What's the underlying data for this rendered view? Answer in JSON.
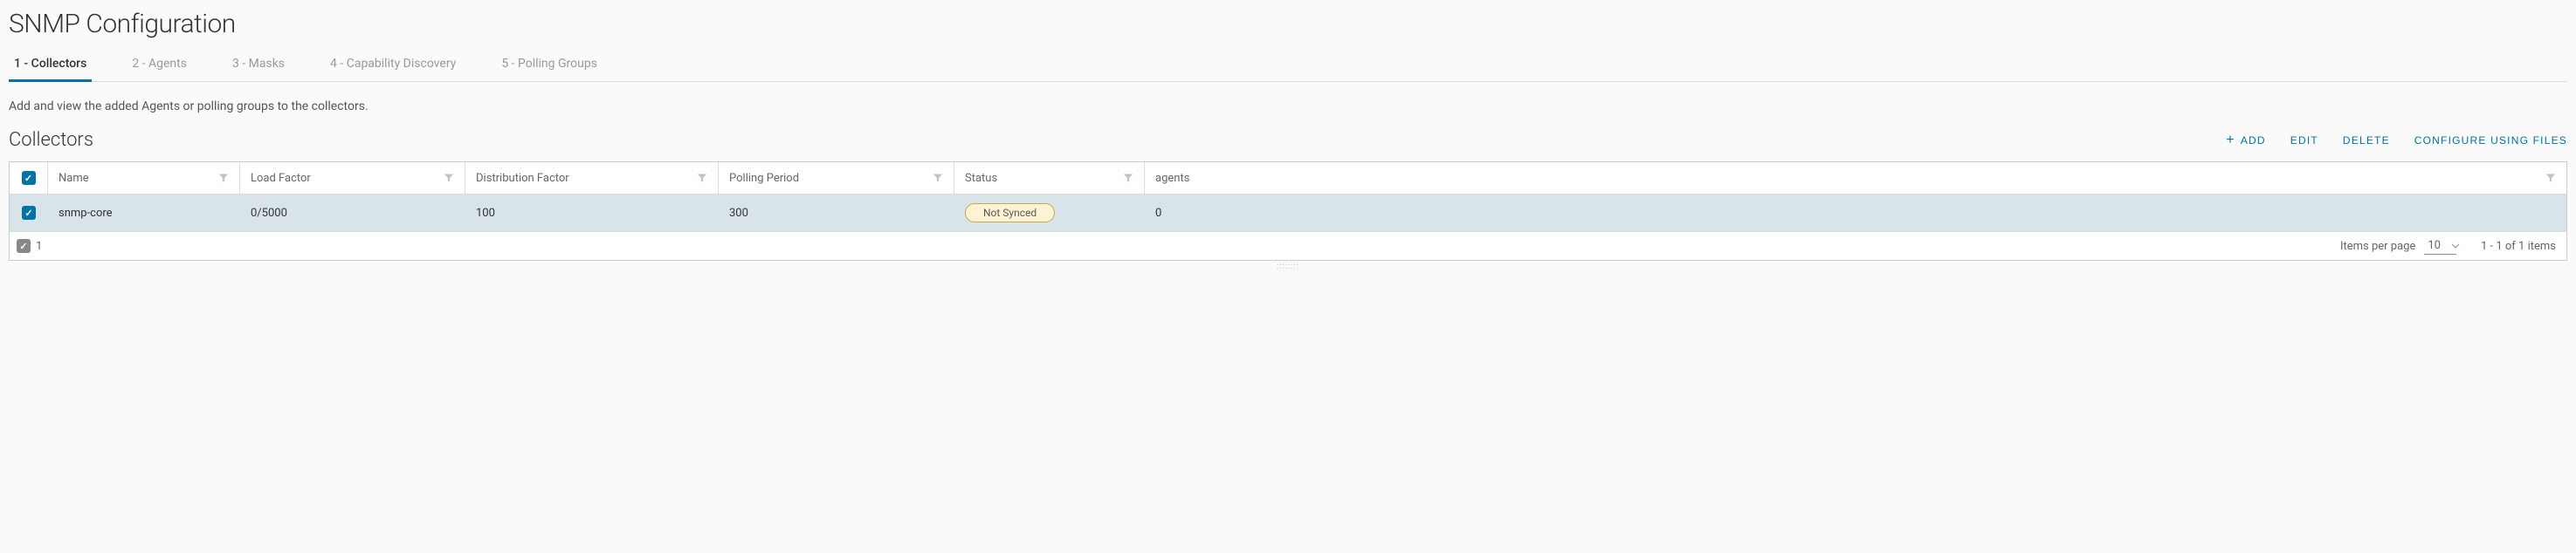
{
  "page": {
    "title": "SNMP Configuration",
    "description": "Add and view the added Agents or polling groups to the collectors."
  },
  "tabs": [
    {
      "label": "1 - Collectors",
      "active": true
    },
    {
      "label": "2 - Agents",
      "active": false
    },
    {
      "label": "3 - Masks",
      "active": false
    },
    {
      "label": "4 - Capability Discovery",
      "active": false
    },
    {
      "label": "5 - Polling Groups",
      "active": false
    }
  ],
  "section": {
    "title": "Collectors"
  },
  "actions": {
    "add": "ADD",
    "edit": "EDIT",
    "delete": "DELETE",
    "configure": "CONFIGURE USING FILES"
  },
  "columns": {
    "name": "Name",
    "load_factor": "Load Factor",
    "distribution_factor": "Distribution Factor",
    "polling_period": "Polling Period",
    "status": "Status",
    "agents": "agents"
  },
  "rows": [
    {
      "checked": true,
      "name": "snmp-core",
      "load_factor": "0/5000",
      "distribution_factor": "100",
      "polling_period": "300",
      "status": "Not Synced",
      "agents": "0"
    }
  ],
  "footer": {
    "selected_count": "1",
    "items_per_page_label": "Items per page",
    "items_per_page_value": "10",
    "range": "1 - 1 of 1 items"
  }
}
